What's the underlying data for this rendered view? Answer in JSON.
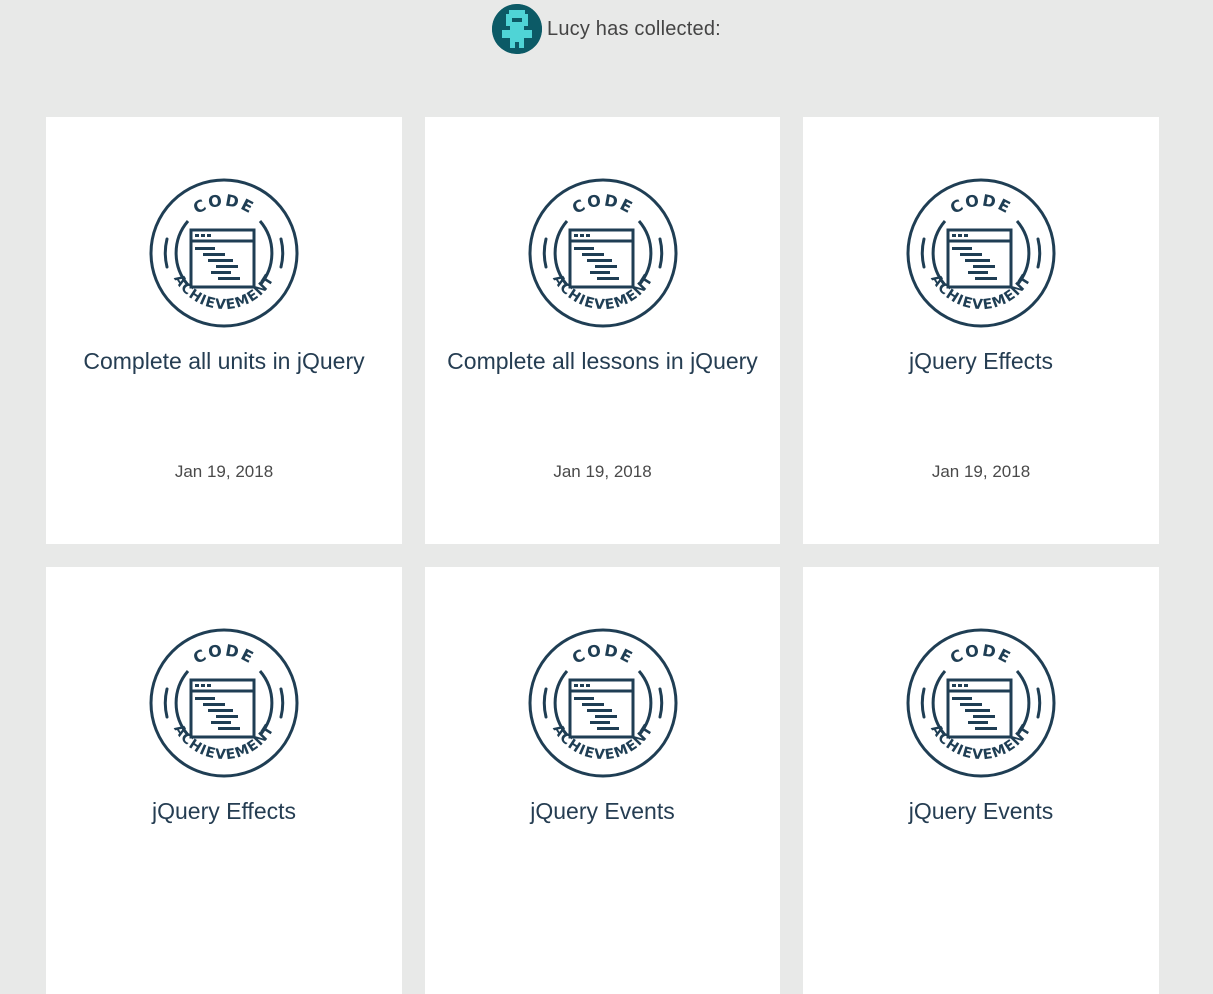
{
  "profile": {
    "collected_text": "Lucy has collected:",
    "avatar_colors": {
      "bg": "#0c5a66",
      "fg": "#4fd4d6"
    }
  },
  "badge": {
    "top_text": "CODE",
    "bottom_text": "ACHIEVEMENT",
    "icon": "code-achievement-badge-icon",
    "color": "#1f3e54"
  },
  "achievements": [
    {
      "title": "Complete all units in jQuery",
      "date": "Jan 19, 2018"
    },
    {
      "title": "Complete all lessons in jQuery",
      "date": "Jan 19, 2018"
    },
    {
      "title": "jQuery Effects",
      "date": "Jan 19, 2018"
    },
    {
      "title": "jQuery Effects",
      "date": ""
    },
    {
      "title": "jQuery Events",
      "date": ""
    },
    {
      "title": "jQuery Events",
      "date": ""
    }
  ]
}
